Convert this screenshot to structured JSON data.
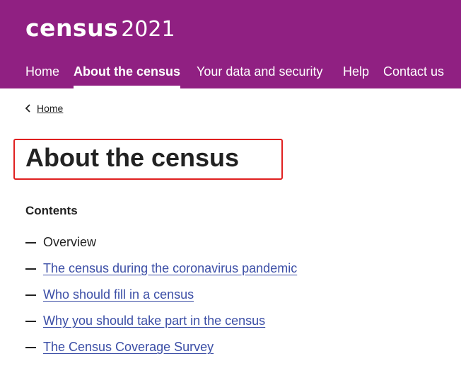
{
  "header": {
    "logo_word": "census",
    "logo_year": "2021",
    "background": "#902082"
  },
  "nav": {
    "items": [
      {
        "label": "Home",
        "active": false
      },
      {
        "label": "About the census",
        "active": true
      },
      {
        "label": "Your data and security",
        "active": false
      },
      {
        "label": "Help",
        "active": false
      },
      {
        "label": "Contact us",
        "active": false
      }
    ]
  },
  "breadcrumb": {
    "icon": "chevron-left-icon",
    "label": "Home"
  },
  "page": {
    "title": "About the census",
    "highlight_color": "#e02020"
  },
  "contents": {
    "heading": "Contents",
    "items": [
      {
        "label": "Overview",
        "is_link": false
      },
      {
        "label": "The census during the coronavirus pandemic",
        "is_link": true
      },
      {
        "label": "Who should fill in a census",
        "is_link": true
      },
      {
        "label": "Why you should take part in the census",
        "is_link": true
      },
      {
        "label": "The Census Coverage Survey",
        "is_link": true
      }
    ],
    "link_color": "#3b4ea6"
  }
}
